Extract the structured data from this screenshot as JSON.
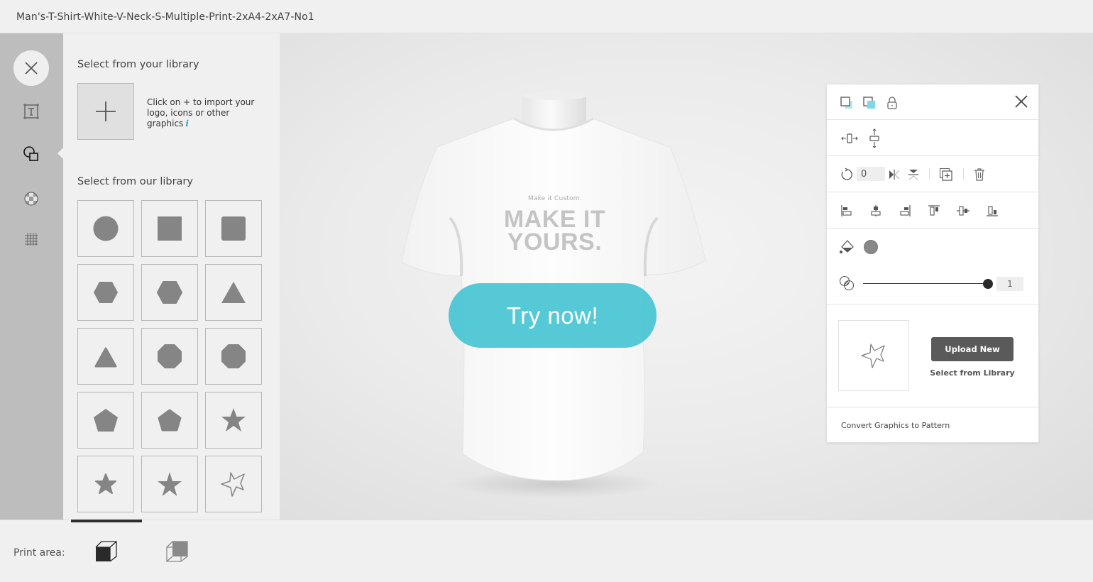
{
  "header": {
    "title": "Man's-T-Shirt-White-V-Neck-S-Multiple-Print-2xA4-2xA7-No1"
  },
  "rail": {
    "items": [
      {
        "name": "close",
        "icon": "close-icon"
      },
      {
        "name": "text",
        "icon": "text-frame-icon"
      },
      {
        "name": "shapes",
        "icon": "shapes-icon",
        "active": true
      },
      {
        "name": "pattern",
        "icon": "checker-ball-icon"
      },
      {
        "name": "grid",
        "icon": "grid-icon"
      }
    ]
  },
  "library": {
    "your_library_title": "Select from your library",
    "import_hint": "Click on + to import your logo, icons or other graphics",
    "info_glyph": "i",
    "our_library_title": "Select from our library",
    "shapes": [
      "circle",
      "square",
      "rounded-square",
      "hexagon",
      "rounded-hexagon",
      "triangle",
      "rounded-triangle",
      "octagon",
      "rounded-octagon",
      "pentagon",
      "rounded-pentagon",
      "star",
      "rounded-star",
      "sharp-star",
      "outline-star"
    ],
    "shape_color": "#858585"
  },
  "canvas": {
    "shirt_tagline": "Make it Custom.",
    "shirt_headline": "MAKE IT YOURS.",
    "cta_label": "Try now!",
    "cta_color": "#48c4d4"
  },
  "properties": {
    "rotation": "0",
    "fill_color": "#888888",
    "opacity": "1",
    "opacity_fraction": 1.0,
    "upload_label": "Upload New",
    "select_library_label": "Select from Library",
    "convert_label": "Convert Graphics to Pattern"
  },
  "footer": {
    "print_area_label": "Print area:",
    "views": [
      "front-view",
      "back-view"
    ],
    "active_view": "front-view"
  }
}
